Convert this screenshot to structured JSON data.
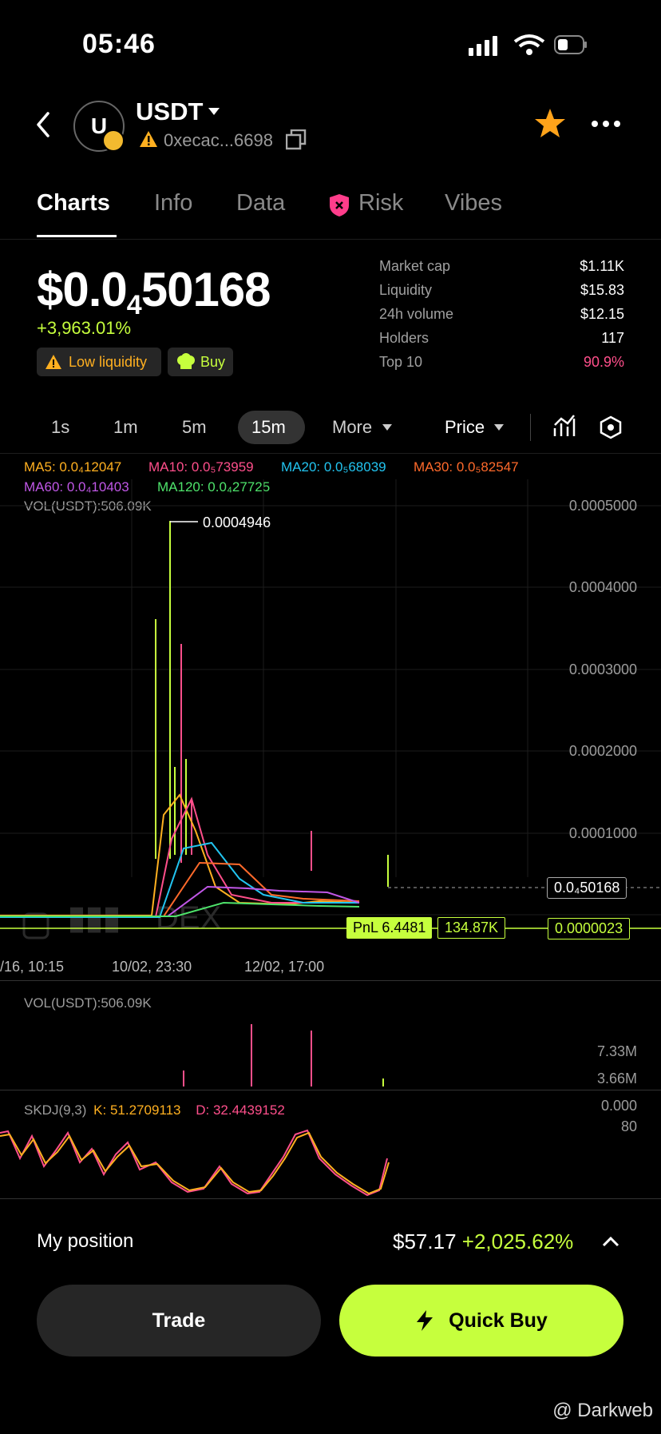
{
  "status": {
    "time": "05:46"
  },
  "header": {
    "avatar_letter": "U",
    "symbol": "USDT",
    "address": "0xecac...6698"
  },
  "tabs": [
    "Charts",
    "Info",
    "Data",
    "Risk",
    "Vibes"
  ],
  "price": {
    "prefix": "$0.0",
    "sub": "4",
    "main": "50168",
    "change": "+3,963.01%"
  },
  "badges": {
    "low_liquidity": "Low liquidity",
    "buy": "Buy"
  },
  "stats": [
    {
      "label": "Market cap",
      "value": "$1.11K"
    },
    {
      "label": "Liquidity",
      "value": "$15.83"
    },
    {
      "label": "24h volume",
      "value": "$12.15"
    },
    {
      "label": "Holders",
      "value": "117"
    },
    {
      "label": "Top 10",
      "value": "90.9%"
    }
  ],
  "timeframes": {
    "t1": "1s",
    "t2": "1m",
    "t3": "5m",
    "t4": "15m",
    "more": "More",
    "price": "Price"
  },
  "ma": {
    "ma5": "MA5: 0.0₄12047",
    "ma10": "MA10: 0.0₅73959",
    "ma20": "MA20: 0.0₅68039",
    "ma30": "MA30: 0.0₅82547",
    "ma60": "MA60: 0.0₄10403",
    "ma120": "MA120: 0.0₄27725",
    "vol": "VOL(USDT):506.09K"
  },
  "chart_data": {
    "type": "line",
    "title": "",
    "y_ticks": [
      "0.0005000",
      "0.0004000",
      "0.0003000",
      "0.0002000",
      "0.0001000"
    ],
    "x_ticks": [
      "/16, 10:15",
      "10/02, 23:30",
      "12/02, 17:00"
    ],
    "high_label": "0.0004946",
    "current_price_label": "0.0₄50168",
    "pnl_label": "PnL 6.4481",
    "pnl_value": "134.87K",
    "entry_price": "0.0000023",
    "watermark": "DEX",
    "ylim": [
      0,
      0.0005
    ]
  },
  "volume_panel": {
    "label": "VOL(USDT):506.09K",
    "ticks": [
      "7.33M",
      "3.66M",
      "0.000"
    ]
  },
  "skdj": {
    "title": "SKDJ(9,3)",
    "k": "K: 51.2709113",
    "d": "D: 32.4439152",
    "tick": "80"
  },
  "position": {
    "label": "My position",
    "value": "$57.17",
    "change": "+2,025.62%"
  },
  "buttons": {
    "trade": "Trade",
    "quick_buy": "Quick Buy"
  },
  "watermark": "@ Darkweb",
  "colors": {
    "accent": "#c6ff3d",
    "ma5": "#ffb020",
    "ma10": "#ff4f8b",
    "ma20": "#22c4f0",
    "ma30": "#ff6a2b",
    "ma60": "#c057e6",
    "ma120": "#4ee36b"
  }
}
